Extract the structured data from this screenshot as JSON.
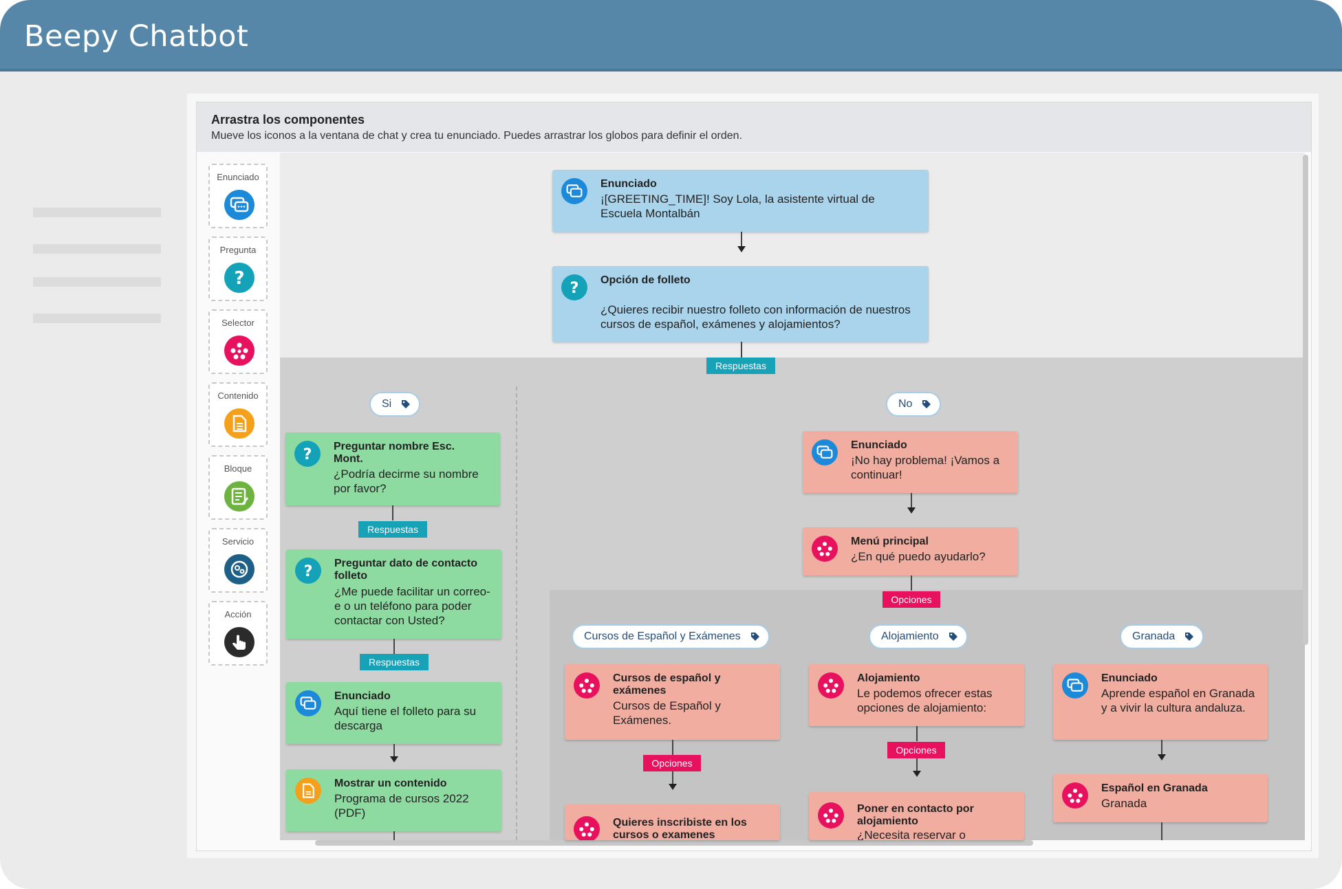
{
  "app": {
    "title": "Beepy Chatbot"
  },
  "header": {
    "title": "Arrastra los componentes",
    "subtitle": "Mueve los iconos a la ventana de chat y crea tu enunciado. Puedes arrastrar los globos para definir el orden."
  },
  "palette": [
    {
      "label": "Enunciado",
      "icon": "chat-bubbles-icon",
      "color": "#1c8ad8"
    },
    {
      "label": "Pregunta",
      "icon": "question-icon",
      "color": "#14a2b8"
    },
    {
      "label": "Selector",
      "icon": "selector-icon",
      "color": "#e8115d"
    },
    {
      "label": "Contenido",
      "icon": "document-icon",
      "color": "#f5a01a"
    },
    {
      "label": "Bloque",
      "icon": "block-icon",
      "color": "#6db33f"
    },
    {
      "label": "Servicio",
      "icon": "service-icon",
      "color": "#1d5f86"
    },
    {
      "label": "Acción",
      "icon": "hand-pointer-icon",
      "color": "#2b2b2b"
    }
  ],
  "nodes": {
    "greeting": {
      "title": "Enunciado",
      "text": "¡[GREETING_TIME]! Soy Lola, la asistente virtual de Escuela Montalbán"
    },
    "brochure_option": {
      "title": "Opción de folleto",
      "text": "¿Quieres recibir nuestro folleto con información de nuestros cursos de español, exámenes y alojamientos?"
    },
    "ask_name": {
      "title": "Preguntar nombre Esc. Mont.",
      "text": "¿Podría decirme su nombre por favor?"
    },
    "ask_contact": {
      "title": "Preguntar dato de contacto folleto",
      "text": "¿Me puede facilitar un correo-e o un teléfono para poder contactar con Usted?"
    },
    "brochure_download": {
      "title": "Enunciado",
      "text": "Aquí tiene el folleto para su descarga"
    },
    "show_content": {
      "title": "Mostrar un contenido",
      "text": "Programa de cursos 2022 (PDF)"
    },
    "no_problem": {
      "title": "Enunciado",
      "text": "¡No hay problema! ¡Vamos a continuar!"
    },
    "main_menu": {
      "title": "Menú principal",
      "text": "¿En qué puedo ayudarlo?"
    },
    "courses": {
      "title": "Cursos de español y exámenes",
      "text": "Cursos de Español y Exámenes."
    },
    "lodging": {
      "title": "Alojamiento",
      "text": "Le podemos ofrecer estas opciones de alojamiento:"
    },
    "granada": {
      "title": "Enunciado",
      "text": "Aprende español en Granada y a vivir la cultura andaluza."
    },
    "enroll": {
      "title": "Quieres inscribiste en los cursos o examenes",
      "text": ""
    },
    "lodging_contact": {
      "title": "Poner en contacto por alojamiento",
      "text": "¿Necesita reservar o"
    },
    "spanish_granada": {
      "title": "Español en Granada",
      "text": "Granada"
    }
  },
  "badges": {
    "responses": "Respuestas",
    "options": "Opciones"
  },
  "tags": {
    "yes": "Si",
    "no": "No",
    "courses": "Cursos de Español y Exámenes",
    "lodging": "Alojamiento",
    "granada": "Granada"
  },
  "colors": {
    "titlebar": "#5687a8",
    "enunciado": "#1c8ad8",
    "pregunta": "#14a2b8",
    "selector": "#e8115d",
    "contenido": "#f5a01a"
  }
}
